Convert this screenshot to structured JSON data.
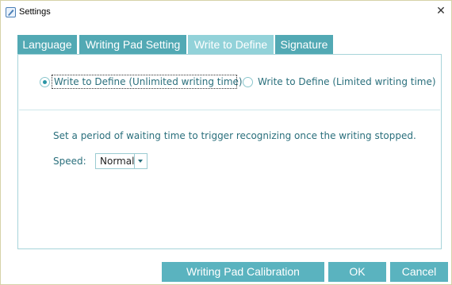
{
  "window": {
    "title": "Settings",
    "close_glyph": "✕",
    "app_icon": "settings-pen-icon"
  },
  "tabs": [
    {
      "label": "Language",
      "active": false
    },
    {
      "label": "Writing Pad Setting",
      "active": false
    },
    {
      "label": "Write to Define",
      "active": true
    },
    {
      "label": "Signature",
      "active": false
    }
  ],
  "mode": {
    "options": [
      {
        "label": "Write to Define (Unlimited writing time)",
        "selected": true
      },
      {
        "label": "Write to Define (Limited writing time)",
        "selected": false
      }
    ]
  },
  "waiting": {
    "description": "Set a period of waiting time to trigger recognizing once the writing stopped.",
    "speed_label": "Speed:",
    "speed_value": "Normal"
  },
  "buttons": {
    "calibration": "Writing Pad Calibration",
    "ok": "OK",
    "cancel": "Cancel"
  },
  "colors": {
    "tab": "#52a9b4",
    "tab_active": "#92d2d9",
    "button": "#5ab3bf",
    "text": "#2a6f7c"
  }
}
